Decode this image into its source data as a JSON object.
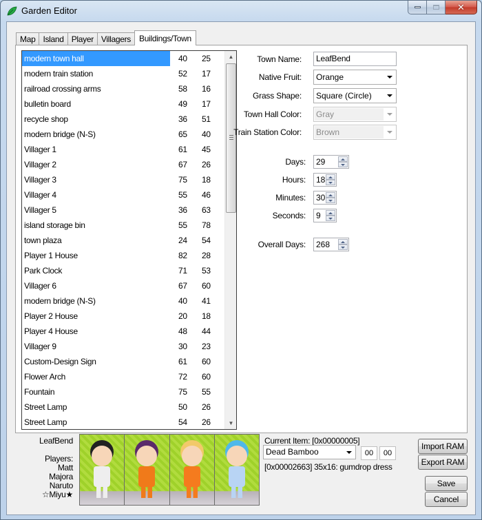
{
  "window": {
    "title": "Garden Editor",
    "app_icon": "leaf-icon",
    "controls": [
      "minimize-icon",
      "maximize-icon",
      "close-icon"
    ]
  },
  "tabs": [
    {
      "label": "Map",
      "active": false
    },
    {
      "label": "Island",
      "active": false
    },
    {
      "label": "Player",
      "active": false
    },
    {
      "label": "Villagers",
      "active": false
    },
    {
      "label": "Buildings/Town",
      "active": true
    }
  ],
  "buildings": {
    "selected_index": 0,
    "rows": [
      {
        "name": "modern town hall",
        "x": "40",
        "y": "25"
      },
      {
        "name": "modern train station",
        "x": "52",
        "y": "17"
      },
      {
        "name": "railroad crossing arms",
        "x": "58",
        "y": "16"
      },
      {
        "name": "bulletin board",
        "x": "49",
        "y": "17"
      },
      {
        "name": "recycle shop",
        "x": "36",
        "y": "51"
      },
      {
        "name": "modern bridge (N-S)",
        "x": "65",
        "y": "40"
      },
      {
        "name": "Villager 1",
        "x": "61",
        "y": "45"
      },
      {
        "name": "Villager 2",
        "x": "67",
        "y": "26"
      },
      {
        "name": "Villager 3",
        "x": "75",
        "y": "18"
      },
      {
        "name": "Villager 4",
        "x": "55",
        "y": "46"
      },
      {
        "name": "Villager 5",
        "x": "36",
        "y": "63"
      },
      {
        "name": "island storage bin",
        "x": "55",
        "y": "78"
      },
      {
        "name": "town plaza",
        "x": "24",
        "y": "54"
      },
      {
        "name": "Player 1 House",
        "x": "82",
        "y": "28"
      },
      {
        "name": "Park Clock",
        "x": "71",
        "y": "53"
      },
      {
        "name": "Villager 6",
        "x": "67",
        "y": "60"
      },
      {
        "name": "modern bridge (N-S)",
        "x": "40",
        "y": "41"
      },
      {
        "name": "Player 2 House",
        "x": "20",
        "y": "18"
      },
      {
        "name": "Player 4 House",
        "x": "48",
        "y": "44"
      },
      {
        "name": "Villager 9",
        "x": "30",
        "y": "23"
      },
      {
        "name": "Custom-Design Sign",
        "x": "61",
        "y": "60"
      },
      {
        "name": "Flower Arch",
        "x": "72",
        "y": "60"
      },
      {
        "name": "Fountain",
        "x": "75",
        "y": "55"
      },
      {
        "name": "Street Lamp",
        "x": "50",
        "y": "26"
      },
      {
        "name": "Street Lamp",
        "x": "54",
        "y": "26"
      }
    ]
  },
  "town": {
    "town_name_label": "Town Name:",
    "town_name": "LeafBend",
    "native_fruit_label": "Native Fruit:",
    "native_fruit": "Orange",
    "grass_shape_label": "Grass Shape:",
    "grass_shape": "Square (Circle)",
    "town_hall_color_label": "Town Hall Color:",
    "town_hall_color": "Gray",
    "train_station_color_label": "Train Station Color:",
    "train_station_color": "Brown"
  },
  "time": {
    "days_label": "Days:",
    "days": "29",
    "hours_label": "Hours:",
    "hours": "18",
    "minutes_label": "Minutes:",
    "minutes": "30",
    "seconds_label": "Seconds:",
    "seconds": "9",
    "overall_days_label": "Overall Days:",
    "overall_days": "268"
  },
  "footer": {
    "town_name": "LeafBend",
    "players_label": "Players:",
    "players": [
      "Matt",
      "Majora",
      "Naruto",
      "☆Miyu★"
    ],
    "portraits": [
      {
        "name": "Matt",
        "outfit": "#eeeeee",
        "hair": "#222222"
      },
      {
        "name": "Majora",
        "outfit": "#f07a1a",
        "hair": "#5a2a6a"
      },
      {
        "name": "Naruto",
        "outfit": "#f57b1e",
        "hair": "#f2c96a"
      },
      {
        "name": "Miyu",
        "outfit": "#b8d4f4",
        "hair": "#4fb8ea"
      }
    ],
    "current_item_label": "Current Item: [0x00000005]",
    "current_item": "Dead Bamboo",
    "item_flag_1": "00",
    "item_flag_2": "00",
    "item_info": "[0x00002663] 35x16: gumdrop dress",
    "import_ram": "Import RAM",
    "export_ram": "Export RAM",
    "save": "Save",
    "cancel": "Cancel"
  }
}
